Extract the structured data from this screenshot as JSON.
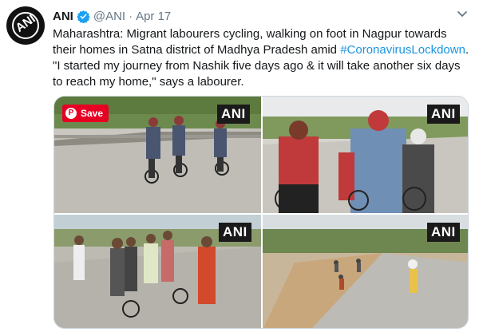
{
  "tweet": {
    "author_name": "ANI",
    "handle": "@ANI",
    "separator": "·",
    "date": "Apr 17",
    "avatar_text": "ANI",
    "text_part1": "Maharashtra: Migrant labourers cycling, walking on foot in Nagpur towards their homes in Satna district of Madhya Pradesh amid ",
    "hashtag": "#CoronavirusLockdown",
    "text_part2": ". \"I started my journey from Nashik five days ago & it will take another six days to reach my home,\" says a labourer."
  },
  "media": {
    "watermark": "ANI",
    "save_label": "Save",
    "pin_glyph": "P"
  },
  "colors": {
    "link": "#1b95e0",
    "verified": "#1da1f2",
    "pinterest": "#e60023",
    "muted": "#657786"
  },
  "icons": [
    "verified-badge-icon",
    "chevron-down-icon",
    "pinterest-icon"
  ]
}
